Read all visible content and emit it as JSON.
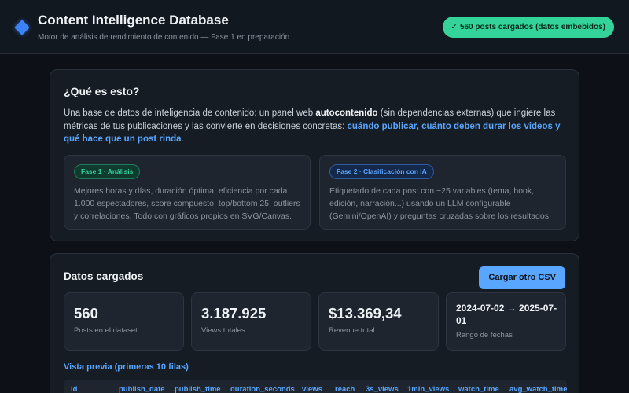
{
  "header": {
    "title": "Content Intelligence Database",
    "subtitle": "Motor de análisis de rendimiento de contenido — Fase 1 en preparación",
    "badge_check": "✓",
    "badge_text": "560 posts cargados (datos embebidos)"
  },
  "about": {
    "title": "¿Qué es esto?",
    "text_1": "Una base de datos de inteligencia de contenido: un panel web ",
    "text_bold": "autocontenido",
    "text_2": " (sin dependencias externas) que ingiere las métricas de tus publicaciones y las convierte en decisiones concretas: ",
    "text_highlight": "cuándo publicar, cuánto deben durar los videos y qué hace que un post rinda",
    "text_end": ".",
    "phases": [
      {
        "badge": "Fase 1 · Análisis",
        "text": "Mejores horas y días, duración óptima, eficiencia por cada 1.000 espectadores, score compuesto, top/bottom 25, outliers y correlaciones. Todo con gráficos propios en SVG/Canvas."
      },
      {
        "badge": "Fase 2 · Clasificación con IA",
        "text": "Etiquetado de cada post con ~25 variables (tema, hook, edición, narración...) usando un LLM configurable (Gemini/OpenAI) y preguntas cruzadas sobre los resultados."
      }
    ]
  },
  "data_section": {
    "title": "Datos cargados",
    "reload_label": "Cargar otro CSV",
    "stats": [
      {
        "value": "560",
        "label": "Posts en el dataset"
      },
      {
        "value": "3.187.925",
        "label": "Views totales"
      },
      {
        "value": "$13.369,34",
        "label": "Revenue total"
      },
      {
        "value": "2024-07-02 → 2025-07-01",
        "label": "Rango de fechas"
      }
    ],
    "preview_title": "Vista previa (primeras 10 filas)",
    "columns": [
      "id",
      "publish_date",
      "publish_time",
      "duration_seconds",
      "views",
      "reach",
      "3s_views",
      "1min_views",
      "watch_time",
      "avg_watch_time"
    ]
  },
  "colors": {
    "accent_blue": "#58a6ff",
    "accent_green": "#34d399",
    "background": "#0d1117",
    "card": "#161c24"
  },
  "icons": {
    "logo": "diamond-icon",
    "badge": "check-icon"
  }
}
